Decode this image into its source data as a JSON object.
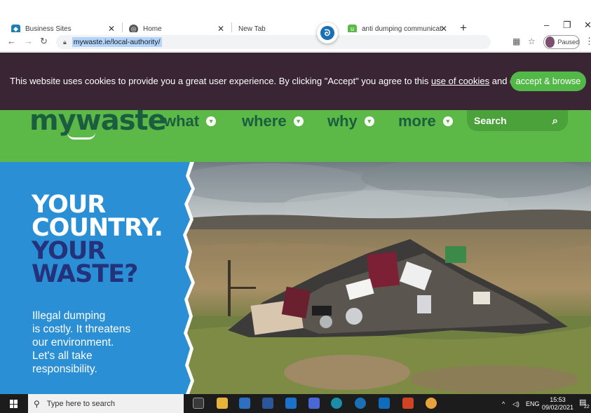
{
  "browser": {
    "tabs": [
      {
        "label": "Business Sites",
        "favicon": "business-sites-icon"
      },
      {
        "label": "Home",
        "favicon": "globe-icon"
      },
      {
        "label": "New Tab",
        "favicon": ""
      },
      {
        "label": "anti dumping communications h",
        "favicon": "mywaste-icon"
      }
    ],
    "url": "mywaste.ie/local-authority/",
    "profile_status": "Paused"
  },
  "cookie_banner": {
    "text_before": "This website uses cookies to provide you a great user experience. By clicking \"Accept\" you agree to this ",
    "link_text": "use of cookies",
    "text_after": " and data.",
    "accept_label": "accept & browse"
  },
  "site_header": {
    "logo": "mywaste",
    "nav": [
      "what",
      "where",
      "why",
      "more"
    ],
    "search_label": "Search"
  },
  "hero": {
    "headline_line1": "YOUR",
    "headline_line2": "COUNTRY.",
    "headline_line3": "YOUR",
    "headline_line4": "WASTE?",
    "body": [
      "Illegal dumping",
      "is costly. It threatens",
      "our environment.",
      "Let's all take",
      "responsibility."
    ]
  },
  "taskbar": {
    "search_placeholder": "Type here to search",
    "language": "ENG",
    "time": "15:53",
    "date": "09/02/2021",
    "notification_count": "22"
  },
  "colors": {
    "cookie_bg": "#3a2534",
    "site_green": "#5db947",
    "logo_green": "#1b5e3f",
    "hero_blue": "#2a8fd4",
    "hero_dark_blue": "#24327c"
  }
}
